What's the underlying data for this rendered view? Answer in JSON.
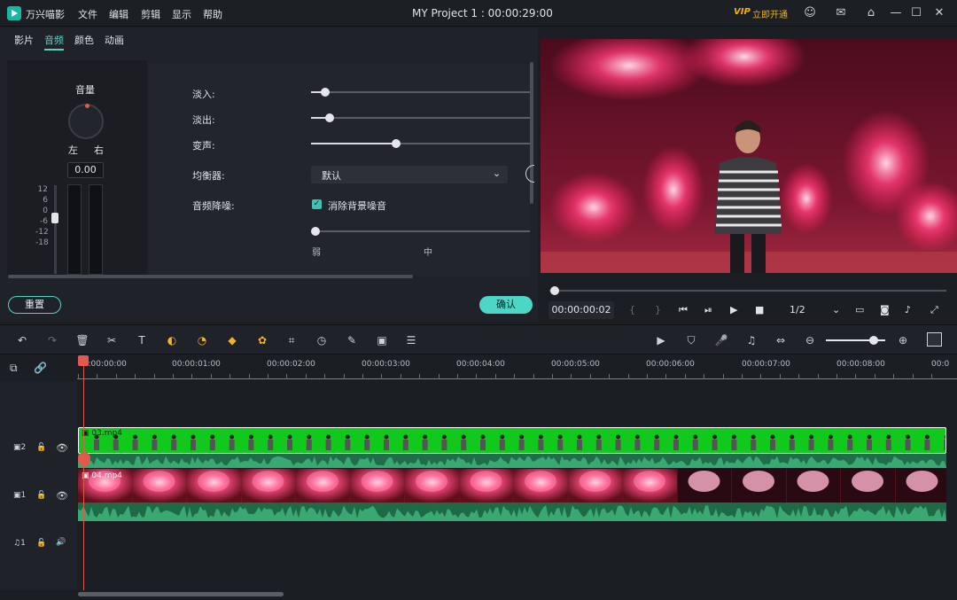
{
  "app": {
    "name": "万兴喵影",
    "menus": [
      "文件",
      "编辑",
      "剪辑",
      "显示",
      "帮助"
    ],
    "title": "MY Project 1 : 00:00:29:00",
    "vip_badge": "VIP",
    "vip_text": "立即开通"
  },
  "panel_tabs": [
    "影片",
    "音频",
    "颜色",
    "动画"
  ],
  "volume": {
    "title": "音量",
    "left": "左",
    "right": "右",
    "value": "0.00",
    "scale": [
      "12",
      "6",
      "0",
      "-6",
      "-12",
      "-18"
    ]
  },
  "settings": {
    "fade_in": {
      "label": "淡入:",
      "value": 0.05
    },
    "fade_out": {
      "label": "淡出:",
      "value": 0.07
    },
    "pitch": {
      "label": "变声:",
      "value": 0.39
    },
    "equalizer": {
      "label": "均衡器:",
      "value": "默认"
    },
    "denoise": {
      "label": "音频降噪:",
      "checkbox_label": "消除背景噪音",
      "checked": true,
      "level_weak": "弱",
      "level_mid": "中",
      "value": 0.0
    }
  },
  "buttons": {
    "reset": "重置",
    "confirm": "确认"
  },
  "player": {
    "timecode": "00:00:00:02",
    "mark_in": "{",
    "mark_out": "}",
    "ratio": "1/2",
    "progress": 0.01
  },
  "timeline": {
    "ruler": [
      "00:00:00:00",
      "00:00:01:00",
      "00:00:02:00",
      "00:00:03:00",
      "00:00:04:00",
      "00:00:05:00",
      "00:00:06:00",
      "00:00:07:00",
      "00:00:08:00",
      "00:0"
    ],
    "tracks": [
      {
        "id": "2",
        "clip": "03.mp4"
      },
      {
        "id": "1",
        "clip": "04.mp4"
      },
      {
        "id": "1",
        "type": "audio"
      }
    ]
  },
  "colors": {
    "accent": "#4dd6c6",
    "playhead": "#e25a4d",
    "green_clip": "#11c81d",
    "vip": "#f5b300"
  }
}
